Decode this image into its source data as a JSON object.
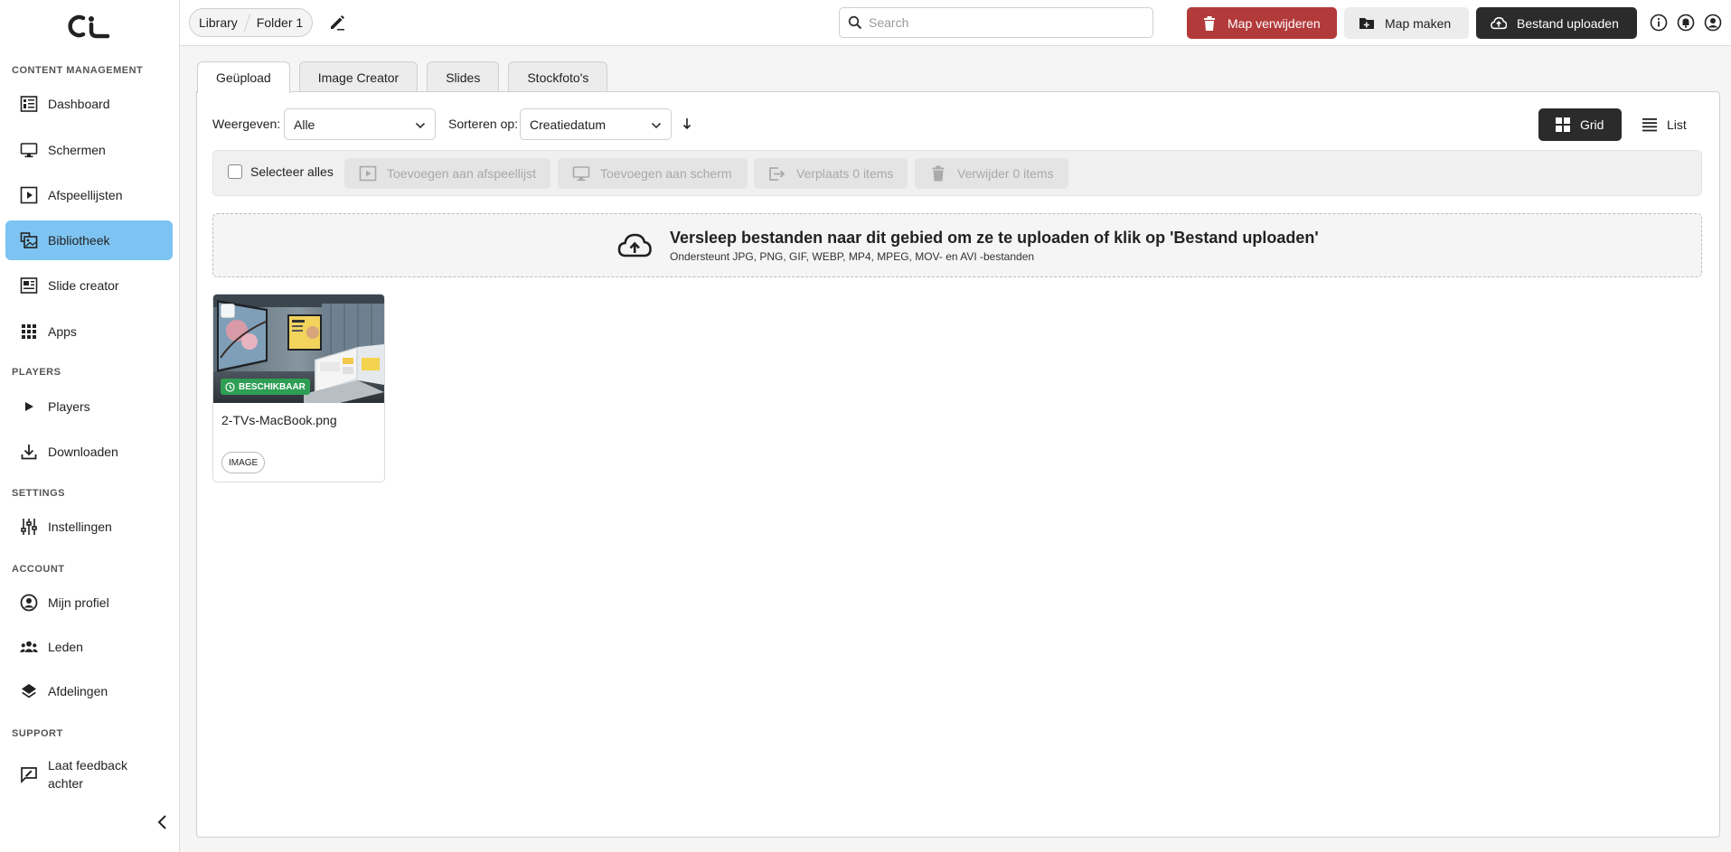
{
  "sidebar": {
    "sections": {
      "content": "CONTENT MANAGEMENT",
      "players": "PLAYERS",
      "settings": "SETTINGS",
      "account": "ACCOUNT",
      "support": "SUPPORT"
    },
    "items": {
      "dashboard": "Dashboard",
      "schermen": "Schermen",
      "afspeellijsten": "Afspeellijsten",
      "bibliotheek": "Bibliotheek",
      "slide_creator": "Slide creator",
      "apps": "Apps",
      "players": "Players",
      "downloaden": "Downloaden",
      "instellingen": "Instellingen",
      "mijn_profiel": "Mijn profiel",
      "leden": "Leden",
      "afdelingen": "Afdelingen",
      "feedback_line1": "Laat feedback",
      "feedback_line2": "achter"
    },
    "active_item": "Bibliotheek"
  },
  "header": {
    "breadcrumb": [
      "Library",
      "Folder 1"
    ],
    "search_placeholder": "Search",
    "btn_delete_folder": "Map verwijderen",
    "btn_make_folder": "Map maken",
    "btn_upload": "Bestand uploaden",
    "colors": {
      "danger": "#b33a3a",
      "dark": "#2b2b2b",
      "active_nav": "#7ec4f2"
    }
  },
  "tabs": [
    "Geüpload",
    "Image Creator",
    "Slides",
    "Stockfoto's"
  ],
  "active_tab": "Geüpload",
  "filters": {
    "show_label": "Weergeven:",
    "show_value": "Alle",
    "sort_label": "Sorteren op:",
    "sort_value": "Creatiedatum",
    "view_grid": "Grid",
    "view_list": "List",
    "active_view": "Grid"
  },
  "actionbar": {
    "select_all": "Selecteer alles",
    "add_playlist": "Toevoegen aan afspeellijst",
    "add_screen": "Toevoegen aan scherm",
    "move": "Verplaats 0 items",
    "delete": "Verwijder 0 items"
  },
  "dropzone": {
    "title": "Versleep bestanden naar dit gebied om ze te uploaden of klik op 'Bestand uploaden'",
    "subtitle": "Ondersteunt JPG, PNG, GIF, WEBP, MP4, MPEG, MOV- en AVI -bestanden"
  },
  "files": [
    {
      "name": "2-TVs-MacBook.png",
      "status": "BESCHIKBAAR",
      "type": "IMAGE",
      "status_color": "#2e9e54"
    }
  ]
}
